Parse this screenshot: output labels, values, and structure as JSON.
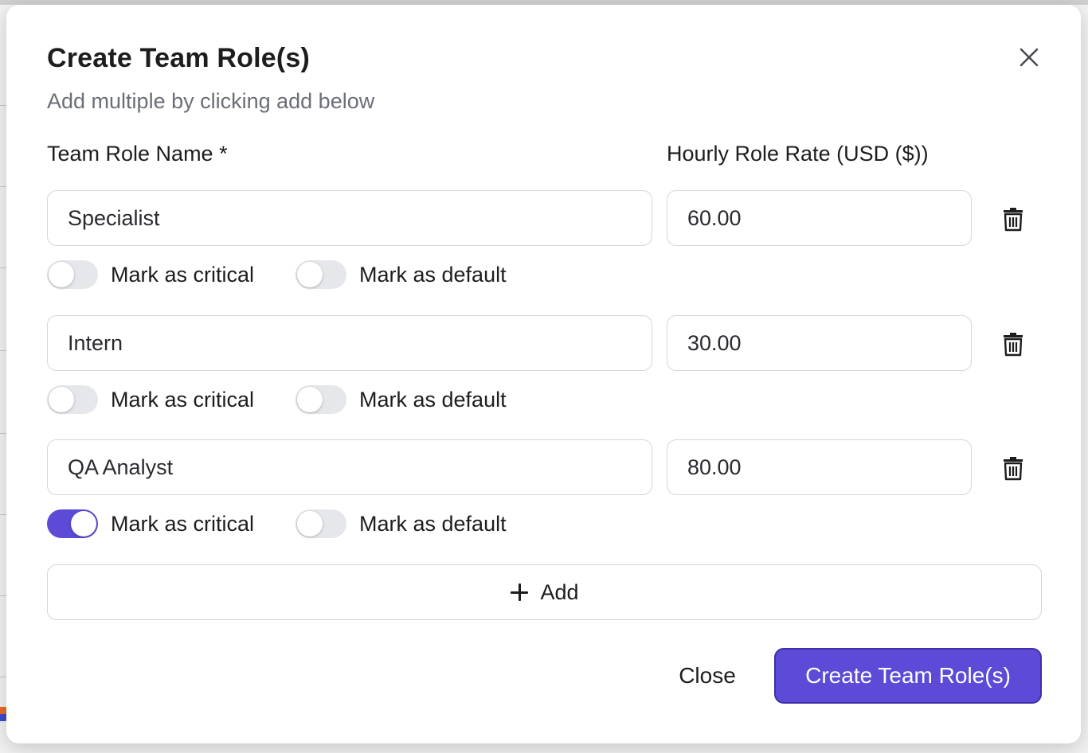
{
  "modal": {
    "title": "Create Team Role(s)",
    "subtitle": "Add multiple by clicking add below",
    "close_icon": "close-icon"
  },
  "columns": {
    "name_label": "Team Role Name *",
    "rate_label": "Hourly Role Rate (USD ($))"
  },
  "roles": [
    {
      "name": "Specialist",
      "rate": "60.00",
      "critical": false,
      "default": false,
      "critical_label": "Mark as critical",
      "default_label": "Mark as default"
    },
    {
      "name": "Intern",
      "rate": "30.00",
      "critical": false,
      "default": false,
      "critical_label": "Mark as critical",
      "default_label": "Mark as default"
    },
    {
      "name": "QA Analyst",
      "rate": "80.00",
      "critical": true,
      "default": false,
      "critical_label": "Mark as critical",
      "default_label": "Mark as default"
    }
  ],
  "actions": {
    "add_label": "Add",
    "close_label": "Close",
    "create_label": "Create Team Role(s)"
  },
  "colors": {
    "accent": "#5b4bd6",
    "toggle_off": "#e6e7ea"
  }
}
